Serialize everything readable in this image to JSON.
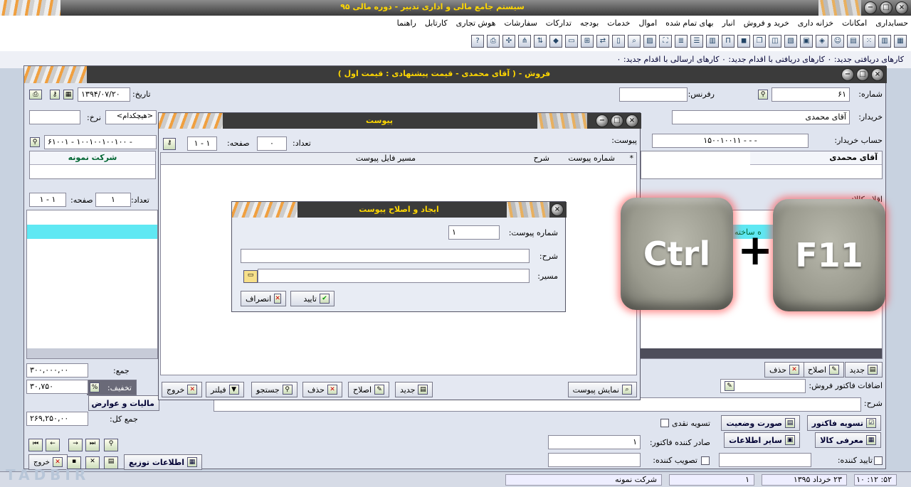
{
  "app": {
    "title": "سیستم جامع مالی و اداری تدبیر - دوره مالی ۹۵"
  },
  "menu": [
    "حسابداری",
    "امکانات",
    "خزانه داری",
    "خرید و فروش",
    "انبار",
    "بهای تمام شده",
    "اموال",
    "خدمات",
    "بودجه",
    "تدارکات",
    "سفارشات",
    "هوش تجاری",
    "کارتابل",
    "راهنما"
  ],
  "notifications": {
    "text": "کارهای دریافتی جدید: ۰    کارهای دریافتی با اقدام جدید: ۰    کارهای ارسالی با اقدام جدید: ۰"
  },
  "sales": {
    "title": "فروش - ( آقای محمدی  - قیمت پیشنهادی : قیمت اول )",
    "number_label": "شماره:",
    "number_value": "۶۱",
    "reference_label": "رفرنس:",
    "date_label": "تاریخ:",
    "date_value": "۱۳۹۴/۰۷/۲۰",
    "buyer_label": "خریدار:",
    "buyer_value": "آقای محمدی",
    "rate_label": "نرخ:",
    "currency_value": "<هیچکدام>",
    "buyer_account_label": "حساب خریدار:",
    "buyer_account_value": "۱۵۰۰۱۰۰۱۱ - - -",
    "seller_account_value": "۶۱۰۰۱ - ۱۰۰۱۰۰۱۰۰۱۰۰ -",
    "buyer_panel": "آقای محمدی",
    "seller_panel": "شرکت نمونه",
    "items_label": "اقلام کالا:",
    "count_label": "تعداد:",
    "count_value": "۱",
    "page_label": "صفحه:",
    "page_value": "۱ - ۱",
    "made_col": "ه ساخته",
    "new_btn": "جدید",
    "edit_btn": "اصلاح",
    "delete_btn": "حذف",
    "sum_label": "جمع:",
    "sum_value": "۳۰۰,۰۰۰,۰۰",
    "discount_label": "تخفیف:",
    "discount_value": "۳۰,۷۵۰",
    "tax_btn": "مالیات و عوارض",
    "total_label": "جمع کل:",
    "total_value": "۲۶۹,۲۵۰,۰۰",
    "additions_label": "اضافات فاکتور فروش:",
    "additions_value": "۰",
    "desc_label": "شرح:",
    "settle_btn": "تسویه فاکتور",
    "status_btn": "صورت وضعیت",
    "cash_settle": "تسویه نقدی",
    "intro_btn": "معرفی کالا",
    "other_btn": "سایر اطلاعات",
    "issuer_label": "صادر کننده فاکتور:",
    "issuer_value": "۱",
    "confirmer_label": "تایید کننده:",
    "approver_label": "تصویب کننده:",
    "distribution_btn": "اطلاعات توزیع",
    "exit_btn": "خروج"
  },
  "attach": {
    "title": "پیوست",
    "attach_label": "پیوست:",
    "count_label": "تعداد:",
    "count_value": "۰",
    "page_label": "صفحه:",
    "page_value": "۱ - ۱",
    "columns": [
      "*",
      "شماره پیوست",
      "شرح",
      "مسیر فایل پیوست"
    ],
    "show_btn": "نمایش پیوست",
    "new_btn": "جدید",
    "edit_btn": "اصلاح",
    "delete_btn": "حذف",
    "search_btn": "جستجو",
    "filter_btn": "فیلتر",
    "exit_btn": "خروج"
  },
  "dialog": {
    "title": "ایجاد و اصلاح پیوست",
    "number_label": "شماره پیوست:",
    "number_value": "۱",
    "desc_label": "شرح:",
    "path_label": "مسیر:",
    "ok_btn": "تایید",
    "cancel_btn": "انصراف"
  },
  "keys": {
    "key1": "Ctrl",
    "plus": "+",
    "key2": "F11"
  },
  "status": {
    "time": "۵۲: ۱۲: ۱۰",
    "date": "۲۳ خرداد ۱۳۹۵",
    "period": "۱",
    "company": "شرکت نمونه"
  },
  "watermark": "TADBIR"
}
